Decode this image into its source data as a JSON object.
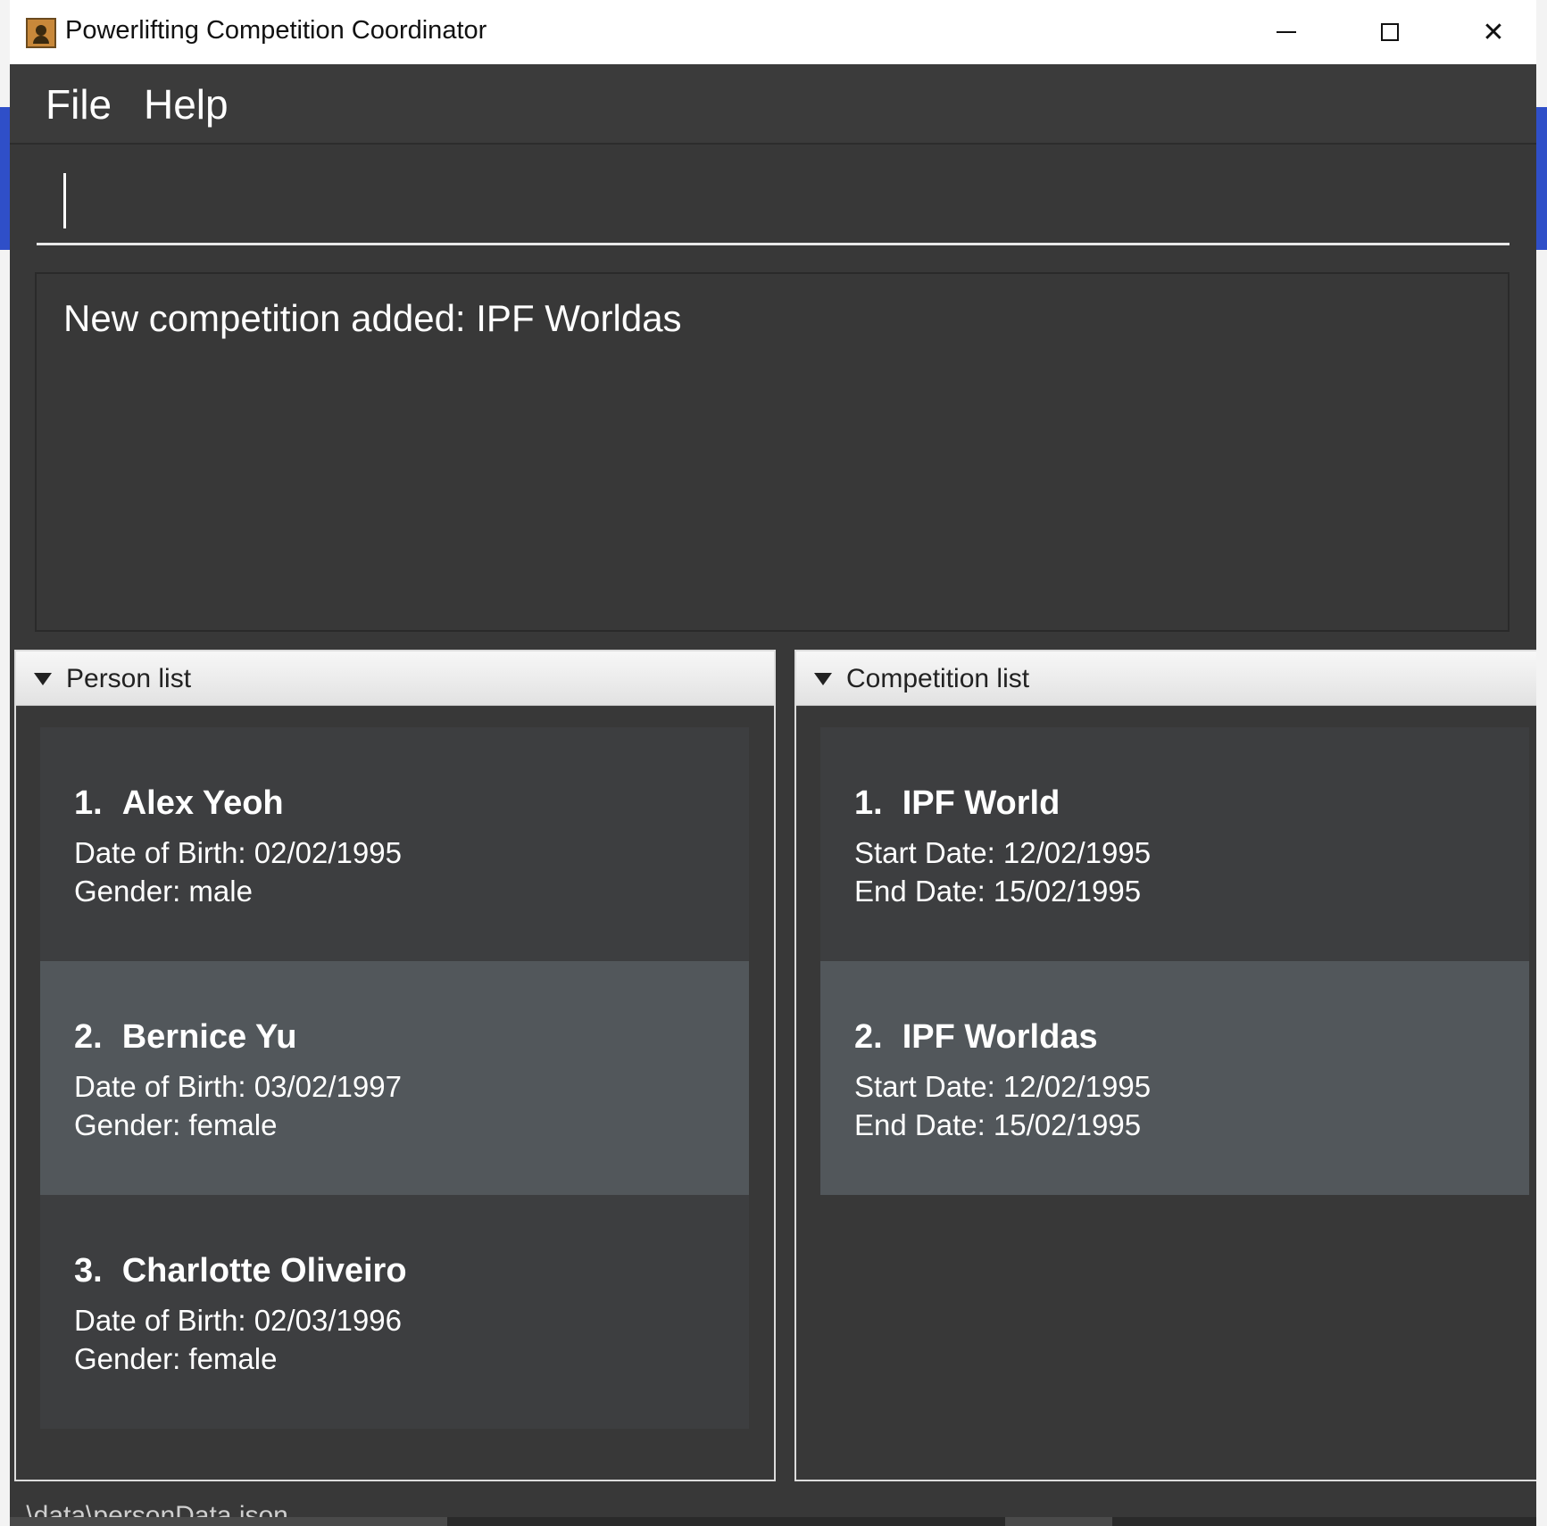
{
  "window": {
    "title": "Powerlifting Competition Coordinator",
    "controls": {
      "minimize": "minimize",
      "maximize": "maximize",
      "close": "✕"
    }
  },
  "menu": {
    "file": "File",
    "help": "Help"
  },
  "command": {
    "value": ""
  },
  "result": {
    "text": "New competition added: IPF Worldas"
  },
  "person_panel": {
    "title": "Person list",
    "items": [
      {
        "index": "1.",
        "name": "Alex Yeoh",
        "line1": "Date of Birth: 02/02/1995",
        "line2": "Gender: male"
      },
      {
        "index": "2.",
        "name": "Bernice Yu",
        "line1": "Date of Birth: 03/02/1997",
        "line2": "Gender: female"
      },
      {
        "index": "3.",
        "name": "Charlotte Oliveiro",
        "line1": "Date of Birth: 02/03/1996",
        "line2": "Gender: female"
      }
    ]
  },
  "competition_panel": {
    "title": "Competition list",
    "items": [
      {
        "index": "1.",
        "name": "IPF World",
        "line1": "Start Date: 12/02/1995",
        "line2": "End Date: 15/02/1995"
      },
      {
        "index": "2.",
        "name": "IPF Worldas",
        "line1": "Start Date: 12/02/1995",
        "line2": "End Date: 15/02/1995"
      }
    ]
  },
  "status": {
    "path": ".\\data\\personData.json"
  },
  "colors": {
    "background": "#383838",
    "card": "#3d3e40",
    "card_selected": "#52575b",
    "text": "#ffffff"
  }
}
